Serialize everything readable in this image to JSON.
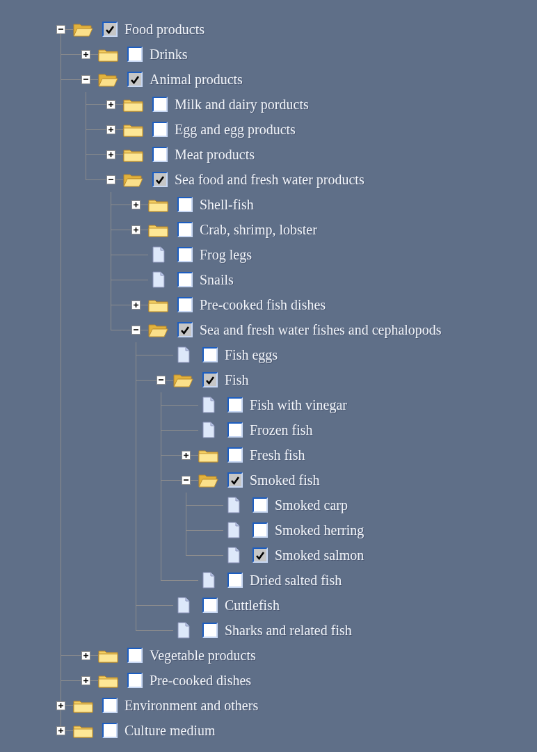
{
  "nodes": [
    {
      "kind": "folder",
      "label": "Food products",
      "expanded": true,
      "checked": true,
      "children": [
        {
          "kind": "folder",
          "label": "Drinks",
          "expanded": false,
          "checked": false
        },
        {
          "kind": "folder",
          "label": "Animal products",
          "expanded": true,
          "checked": true,
          "children": [
            {
              "kind": "folder",
              "label": "Milk and dairy porducts",
              "expanded": false,
              "checked": false
            },
            {
              "kind": "folder",
              "label": "Egg and egg products",
              "expanded": false,
              "checked": false
            },
            {
              "kind": "folder",
              "label": "Meat products",
              "expanded": false,
              "checked": false
            },
            {
              "kind": "folder",
              "label": "Sea food and fresh water products",
              "expanded": true,
              "checked": true,
              "children": [
                {
                  "kind": "folder",
                  "label": "Shell-fish",
                  "expanded": false,
                  "checked": false
                },
                {
                  "kind": "folder",
                  "label": "Crab, shrimp, lobster",
                  "expanded": false,
                  "checked": false
                },
                {
                  "kind": "file",
                  "label": "Frog legs",
                  "checked": false
                },
                {
                  "kind": "file",
                  "label": "Snails",
                  "checked": false
                },
                {
                  "kind": "folder",
                  "label": "Pre-cooked fish dishes",
                  "expanded": false,
                  "checked": false
                },
                {
                  "kind": "folder",
                  "label": "Sea and fresh water fishes and cephalopods",
                  "expanded": true,
                  "checked": true,
                  "children": [
                    {
                      "kind": "file",
                      "label": "Fish eggs",
                      "checked": false
                    },
                    {
                      "kind": "folder",
                      "label": "Fish",
                      "expanded": true,
                      "checked": true,
                      "children": [
                        {
                          "kind": "file",
                          "label": "Fish with vinegar",
                          "checked": false
                        },
                        {
                          "kind": "file",
                          "label": "Frozen fish",
                          "checked": false
                        },
                        {
                          "kind": "folder",
                          "label": "Fresh fish",
                          "expanded": false,
                          "checked": false
                        },
                        {
                          "kind": "folder",
                          "label": "Smoked fish",
                          "expanded": true,
                          "checked": true,
                          "children": [
                            {
                              "kind": "file",
                              "label": "Smoked carp",
                              "checked": false
                            },
                            {
                              "kind": "file",
                              "label": "Smoked herring",
                              "checked": false
                            },
                            {
                              "kind": "file",
                              "label": "Smoked salmon",
                              "checked": true
                            }
                          ]
                        },
                        {
                          "kind": "file",
                          "label": "Dried salted fish",
                          "checked": false
                        }
                      ]
                    },
                    {
                      "kind": "file",
                      "label": "Cuttlefish",
                      "checked": false
                    },
                    {
                      "kind": "file",
                      "label": "Sharks and related fish",
                      "checked": false
                    }
                  ]
                }
              ]
            }
          ]
        },
        {
          "kind": "folder",
          "label": "Vegetable products",
          "expanded": false,
          "checked": false
        },
        {
          "kind": "folder",
          "label": "Pre-cooked dishes",
          "expanded": false,
          "checked": false
        }
      ]
    },
    {
      "kind": "folder",
      "label": "Environment and others",
      "expanded": false,
      "checked": false
    },
    {
      "kind": "folder",
      "label": "Culture medium",
      "expanded": false,
      "checked": false
    }
  ]
}
